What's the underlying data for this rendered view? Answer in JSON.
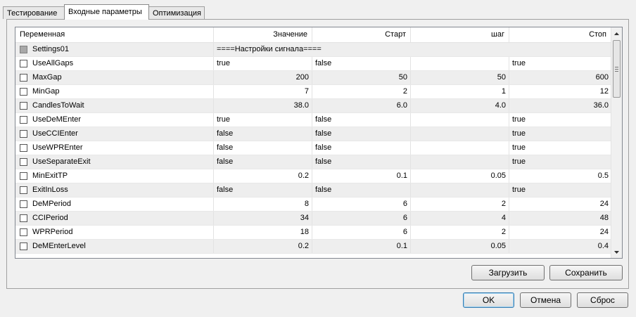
{
  "tabs": [
    "Тестирование",
    "Входные параметры",
    "Оптимизация"
  ],
  "active_tab": "Входные параметры",
  "columns": [
    "Переменная",
    "Значение",
    "Старт",
    "шаг",
    "Стоп"
  ],
  "rows": [
    {
      "name": "Settings01",
      "value": "====Настройки сигнала====",
      "start": "",
      "step": "",
      "stop": ""
    },
    {
      "name": "UseAllGaps",
      "value": "true",
      "start": "false",
      "step": "",
      "stop": "true"
    },
    {
      "name": "MaxGap",
      "value": "200",
      "start": "50",
      "step": "50",
      "stop": "600"
    },
    {
      "name": "MinGap",
      "value": "7",
      "start": "2",
      "step": "1",
      "stop": "12"
    },
    {
      "name": "CandlesToWait",
      "value": "38.0",
      "start": "6.0",
      "step": "4.0",
      "stop": "36.0"
    },
    {
      "name": "UseDeMEnter",
      "value": "true",
      "start": "false",
      "step": "",
      "stop": "true"
    },
    {
      "name": "UseCCIEnter",
      "value": "false",
      "start": "false",
      "step": "",
      "stop": "true"
    },
    {
      "name": "UseWPREnter",
      "value": "false",
      "start": "false",
      "step": "",
      "stop": "true"
    },
    {
      "name": "UseSeparateExit",
      "value": "false",
      "start": "false",
      "step": "",
      "stop": "true"
    },
    {
      "name": "MinExitTP",
      "value": "0.2",
      "start": "0.1",
      "step": "0.05",
      "stop": "0.5"
    },
    {
      "name": "ExitInLoss",
      "value": "false",
      "start": "false",
      "step": "",
      "stop": "true"
    },
    {
      "name": "DeMPeriod",
      "value": "8",
      "start": "6",
      "step": "2",
      "stop": "24"
    },
    {
      "name": "CCIPeriod",
      "value": "34",
      "start": "6",
      "step": "4",
      "stop": "48"
    },
    {
      "name": "WPRPeriod",
      "value": "18",
      "start": "6",
      "step": "2",
      "stop": "24"
    },
    {
      "name": "DeMEnterLevel",
      "value": "0.2",
      "start": "0.1",
      "step": "0.05",
      "stop": "0.4"
    }
  ],
  "buttons": {
    "load": "Загрузить",
    "save": "Сохранить",
    "ok": "OK",
    "cancel": "Отмена",
    "reset": "Сброс"
  },
  "icons": {
    "scroll_up": "scroll-up-arrow-icon",
    "scroll_down": "scroll-down-arrow-icon",
    "thumb_grip": "scroll-thumb-grip-icon"
  }
}
